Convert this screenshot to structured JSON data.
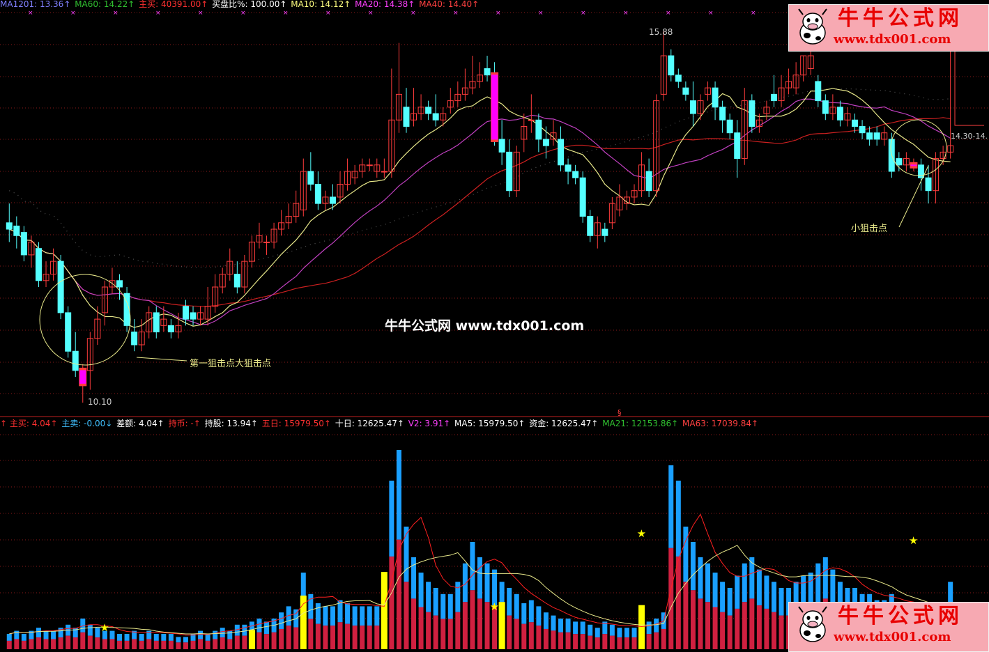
{
  "top_header": [
    {
      "label": "MA1201: ",
      "value": "13.36",
      "arrow": "↑",
      "color": "#8080ff"
    },
    {
      "label": "MA60: ",
      "value": "14.22",
      "arrow": "↑",
      "color": "#30c030"
    },
    {
      "label": "主买: ",
      "value": "40391.00",
      "arrow": "↑",
      "color": "#ff3030"
    },
    {
      "label": "买盘比%: ",
      "value": "100.00",
      "arrow": "↑",
      "color": "#ffffff"
    },
    {
      "label": "MA10: ",
      "value": "14.12",
      "arrow": "↑",
      "color": "#ffff80"
    },
    {
      "label": "MA20: ",
      "value": "14.38",
      "arrow": "↑",
      "color": "#ff40ff"
    },
    {
      "label": "MA40: ",
      "value": "14.40",
      "arrow": "↑",
      "color": "#ff4040"
    }
  ],
  "bottom_header": [
    {
      "label": "主买: ",
      "value": "4.04",
      "arrow": "↑",
      "color": "#ff3030",
      "prefix": "↑ "
    },
    {
      "label": "主卖: ",
      "value": "-0.00",
      "arrow": "↓",
      "color": "#40c0ff"
    },
    {
      "label": "差额: ",
      "value": "4.04",
      "arrow": "↑",
      "color": "#ffffff"
    },
    {
      "label": "持币: ",
      "value": "-",
      "arrow": "↑",
      "color": "#ff3030"
    },
    {
      "label": "持股: ",
      "value": "13.94",
      "arrow": "↑",
      "color": "#ffffff"
    },
    {
      "label": "五日: ",
      "value": "15979.50",
      "arrow": "↑",
      "color": "#ff3030"
    },
    {
      "label": "十日: ",
      "value": "12625.47",
      "arrow": "↑",
      "color": "#ffffff"
    },
    {
      "label": "V2: ",
      "value": "3.91",
      "arrow": "↑",
      "color": "#ff40ff"
    },
    {
      "label": "MA5: ",
      "value": "15979.50",
      "arrow": "↑",
      "color": "#ffffff"
    },
    {
      "label": "资金: ",
      "value": "12625.47",
      "arrow": "↑",
      "color": "#ffffff"
    },
    {
      "label": "MA21: ",
      "value": "12153.86",
      "arrow": "↑",
      "color": "#30c030"
    },
    {
      "label": "MA63: ",
      "value": "17039.84",
      "arrow": "↑",
      "color": "#ff4040"
    }
  ],
  "watermark": {
    "site_name": "牛牛公式网",
    "url": "www.tdx001.com"
  },
  "center_watermark": "牛牛公式网 www.tdx001.com",
  "annotations": {
    "big_entry": "第一狙击点大狙击点",
    "small_entry": "小狙击点",
    "price_high": "15.88",
    "price_low": "10.10",
    "price_right": "14.30-14.",
    "section_marker": "§"
  },
  "colors": {
    "up": "#ff3c3c",
    "down": "#54ffff",
    "signal": "#ff00ff",
    "ma_yellow": "#e8e88a",
    "ma_purple": "#c040c0",
    "ma_red": "#cc2020",
    "grid": "#8b1a1a",
    "vol_red": "#d02040",
    "vol_blue": "#1aa0ff",
    "vol_yellow": "#ffff00"
  },
  "chart_data": {
    "type": "candlestick",
    "description_units": "price",
    "ylim": [
      10.1,
      15.88
    ],
    "candles": [
      [
        12.9,
        12.8,
        13.2,
        12.6
      ],
      [
        12.85,
        12.7,
        13.0,
        12.5
      ],
      [
        12.75,
        12.4,
        12.85,
        12.3
      ],
      [
        12.4,
        12.6,
        12.7,
        12.2
      ],
      [
        12.5,
        12.0,
        12.6,
        11.9
      ],
      [
        12.0,
        12.1,
        12.3,
        11.9
      ],
      [
        12.1,
        12.3,
        12.5,
        12.0
      ],
      [
        12.3,
        11.5,
        12.4,
        11.4
      ],
      [
        11.5,
        10.9,
        11.6,
        10.8
      ],
      [
        10.9,
        10.6,
        11.2,
        10.5
      ],
      [
        10.4,
        10.6,
        10.7,
        10.1
      ],
      [
        10.6,
        11.1,
        11.2,
        10.3
      ],
      [
        11.1,
        11.4,
        11.6,
        11.0
      ],
      [
        11.5,
        11.9,
        12.0,
        11.3
      ],
      [
        11.9,
        12.0,
        12.2,
        11.8
      ],
      [
        12.0,
        11.9,
        12.1,
        11.7
      ],
      [
        11.8,
        11.3,
        11.9,
        11.2
      ],
      [
        11.2,
        11.0,
        11.4,
        10.9
      ],
      [
        11.0,
        11.2,
        11.4,
        10.9
      ],
      [
        11.2,
        11.5,
        11.6,
        11.1
      ],
      [
        11.5,
        11.2,
        11.6,
        11.1
      ],
      [
        11.3,
        11.4,
        11.6,
        11.2
      ],
      [
        11.3,
        11.2,
        11.4,
        11.1
      ],
      [
        11.2,
        11.3,
        11.5,
        11.1
      ],
      [
        11.6,
        11.4,
        11.7,
        11.3
      ],
      [
        11.5,
        11.4,
        11.6,
        11.3
      ],
      [
        11.4,
        11.5,
        11.6,
        11.3
      ],
      [
        11.4,
        11.6,
        11.9,
        11.3
      ],
      [
        11.6,
        11.9,
        12.1,
        11.5
      ],
      [
        11.9,
        12.1,
        12.2,
        11.8
      ],
      [
        12.1,
        12.3,
        12.5,
        12.0
      ],
      [
        12.1,
        11.9,
        12.3,
        11.8
      ],
      [
        11.9,
        12.3,
        12.4,
        11.8
      ],
      [
        12.3,
        12.6,
        12.7,
        12.2
      ],
      [
        12.6,
        12.7,
        12.9,
        12.5
      ],
      [
        12.6,
        12.6,
        12.7,
        12.4
      ],
      [
        12.6,
        12.8,
        12.9,
        12.5
      ],
      [
        12.8,
        12.9,
        13.1,
        12.7
      ],
      [
        12.9,
        13.0,
        13.2,
        12.8
      ],
      [
        13.0,
        13.2,
        13.4,
        12.9
      ],
      [
        13.1,
        13.7,
        13.9,
        13.0
      ],
      [
        13.7,
        13.5,
        14.0,
        13.4
      ],
      [
        13.5,
        13.2,
        13.7,
        13.1
      ],
      [
        13.2,
        13.3,
        13.4,
        13.1
      ],
      [
        13.3,
        13.2,
        13.5,
        13.1
      ],
      [
        13.3,
        13.5,
        13.7,
        13.2
      ],
      [
        13.5,
        13.7,
        13.9,
        13.4
      ],
      [
        13.6,
        13.7,
        13.8,
        13.5
      ],
      [
        13.7,
        13.8,
        13.9,
        13.6
      ],
      [
        13.8,
        13.8,
        13.9,
        13.7
      ],
      [
        13.7,
        13.8,
        13.9,
        13.6
      ],
      [
        13.7,
        13.7,
        13.9,
        13.6
      ],
      [
        13.7,
        14.5,
        15.3,
        13.6
      ],
      [
        14.5,
        14.9,
        15.7,
        14.3
      ],
      [
        14.7,
        14.4,
        15.0,
        14.3
      ],
      [
        14.5,
        14.6,
        15.0,
        14.4
      ],
      [
        14.6,
        14.7,
        14.9,
        14.5
      ],
      [
        14.7,
        14.6,
        14.8,
        14.5
      ],
      [
        14.6,
        14.5,
        14.9,
        14.4
      ],
      [
        14.5,
        14.6,
        14.7,
        14.4
      ],
      [
        14.7,
        14.8,
        15.0,
        14.6
      ],
      [
        14.8,
        14.9,
        15.1,
        14.7
      ],
      [
        14.9,
        15.0,
        15.3,
        14.8
      ],
      [
        15.0,
        15.1,
        15.5,
        14.9
      ],
      [
        15.1,
        15.2,
        15.4,
        15.0
      ],
      [
        15.3,
        15.2,
        15.5,
        15.1
      ],
      [
        15.2,
        14.2,
        15.4,
        14.1
      ],
      [
        14.2,
        14.0,
        14.5,
        13.8
      ],
      [
        14.0,
        13.4,
        14.2,
        13.3
      ],
      [
        13.4,
        14.0,
        14.1,
        13.3
      ],
      [
        14.2,
        14.4,
        14.6,
        14.0
      ],
      [
        14.5,
        14.5,
        14.9,
        14.3
      ],
      [
        14.5,
        14.2,
        14.6,
        14.0
      ],
      [
        14.2,
        14.1,
        14.4,
        13.9
      ],
      [
        14.2,
        14.3,
        14.5,
        14.1
      ],
      [
        14.2,
        13.8,
        14.4,
        13.7
      ],
      [
        13.8,
        13.7,
        13.9,
        13.5
      ],
      [
        13.7,
        13.6,
        13.8,
        13.5
      ],
      [
        13.6,
        13.0,
        13.7,
        12.9
      ],
      [
        13.0,
        12.7,
        13.1,
        12.6
      ],
      [
        12.7,
        12.9,
        13.0,
        12.5
      ],
      [
        12.8,
        12.7,
        12.9,
        12.6
      ],
      [
        12.9,
        13.2,
        13.3,
        12.8
      ],
      [
        13.1,
        13.3,
        13.5,
        13.0
      ],
      [
        13.2,
        13.3,
        13.4,
        13.1
      ],
      [
        13.3,
        13.4,
        13.5,
        13.2
      ],
      [
        13.4,
        13.8,
        14.0,
        13.3
      ],
      [
        13.7,
        13.4,
        13.9,
        13.3
      ],
      [
        13.4,
        14.8,
        14.9,
        13.3
      ],
      [
        14.9,
        15.5,
        15.88,
        14.8
      ],
      [
        15.5,
        15.2,
        15.6,
        15.1
      ],
      [
        15.2,
        15.1,
        15.3,
        15.0
      ],
      [
        15.0,
        14.9,
        15.1,
        14.8
      ],
      [
        14.8,
        14.6,
        15.1,
        14.4
      ],
      [
        14.6,
        14.8,
        14.9,
        14.5
      ],
      [
        14.9,
        15.0,
        15.1,
        14.8
      ],
      [
        15.0,
        14.7,
        15.1,
        14.5
      ],
      [
        14.7,
        14.5,
        14.8,
        14.3
      ],
      [
        14.5,
        14.3,
        14.6,
        14.2
      ],
      [
        14.3,
        13.9,
        14.5,
        13.6
      ],
      [
        13.9,
        14.8,
        15.0,
        13.8
      ],
      [
        14.8,
        14.4,
        14.9,
        14.3
      ],
      [
        14.4,
        14.5,
        14.6,
        14.3
      ],
      [
        14.6,
        14.7,
        14.8,
        14.5
      ],
      [
        14.9,
        14.8,
        15.2,
        14.7
      ],
      [
        14.8,
        15.0,
        15.2,
        14.7
      ],
      [
        15.0,
        15.1,
        15.3,
        14.9
      ],
      [
        15.0,
        15.2,
        15.4,
        14.9
      ],
      [
        15.2,
        15.5,
        15.5,
        15.1
      ],
      [
        15.3,
        15.5,
        15.6,
        15.2
      ],
      [
        15.1,
        14.8,
        15.2,
        14.7
      ],
      [
        14.8,
        14.6,
        14.9,
        14.5
      ],
      [
        14.6,
        14.7,
        14.9,
        14.5
      ],
      [
        14.7,
        14.5,
        14.8,
        14.4
      ],
      [
        14.5,
        14.6,
        14.7,
        14.4
      ],
      [
        14.5,
        14.4,
        14.6,
        14.3
      ],
      [
        14.4,
        14.3,
        14.5,
        14.2
      ],
      [
        14.3,
        14.2,
        14.4,
        14.1
      ],
      [
        14.3,
        14.2,
        14.4,
        14.1
      ],
      [
        14.2,
        14.3,
        14.4,
        14.1
      ],
      [
        14.2,
        13.7,
        14.3,
        13.6
      ],
      [
        13.9,
        13.8,
        14.0,
        13.7
      ],
      [
        13.8,
        13.9,
        14.0,
        13.7
      ],
      [
        13.8,
        13.8,
        13.9,
        13.7
      ],
      [
        13.8,
        13.6,
        13.9,
        13.4
      ],
      [
        13.6,
        13.4,
        13.8,
        13.2
      ],
      [
        13.4,
        13.9,
        14.0,
        13.2
      ],
      [
        13.9,
        14.0,
        14.1,
        13.8
      ],
      [
        14.0,
        14.1,
        15.6,
        13.9
      ]
    ],
    "signal_candles": [
      10,
      66,
      123
    ],
    "volume_series": [
      {
        "name": "vol",
        "values": [
          5,
          6,
          5,
          6,
          7,
          6,
          6,
          7,
          8,
          7,
          10,
          8,
          7,
          6,
          6,
          5,
          5,
          6,
          5,
          6,
          5,
          5,
          5,
          4,
          4,
          5,
          6,
          5,
          6,
          7,
          6,
          8,
          8,
          9,
          10,
          9,
          10,
          12,
          14,
          13,
          25,
          18,
          15,
          14,
          14,
          16,
          15,
          14,
          14,
          14,
          14,
          14,
          55,
          65,
          40,
          30,
          25,
          22,
          20,
          18,
          18,
          22,
          28,
          35,
          30,
          28,
          26,
          22,
          20,
          18,
          15,
          16,
          14,
          12,
          11,
          10,
          10,
          9,
          9,
          8,
          7,
          9,
          8,
          7,
          7,
          7,
          8,
          9,
          10,
          12,
          60,
          55,
          40,
          35,
          30,
          28,
          25,
          22,
          20,
          24,
          28,
          30,
          26,
          24,
          22,
          20,
          20,
          22,
          24,
          25,
          28,
          30,
          26,
          22,
          20,
          20,
          18,
          18,
          16,
          16,
          18,
          15,
          14,
          14,
          12,
          12,
          14,
          15,
          22
        ]
      }
    ]
  }
}
